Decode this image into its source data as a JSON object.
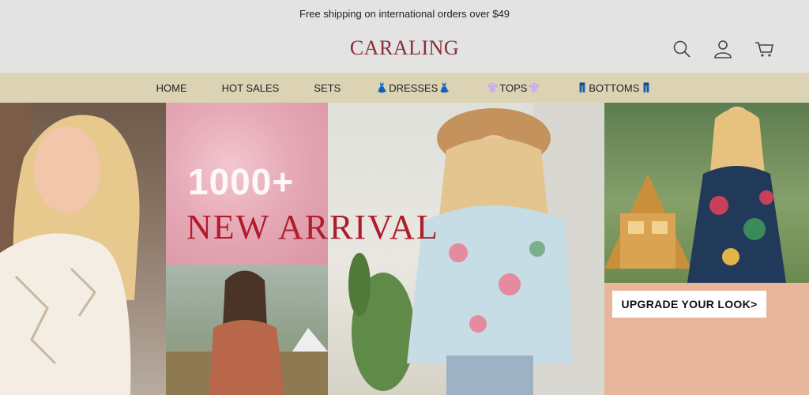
{
  "announcement": "Free shipping on international orders over $49",
  "header": {
    "logo": "CARALING",
    "icons": [
      "search-icon",
      "account-icon",
      "cart-icon"
    ]
  },
  "nav": {
    "items": [
      {
        "label": "HOME"
      },
      {
        "label": "HOT SALES"
      },
      {
        "label": "SETS"
      },
      {
        "label": "DRESSES",
        "emoji": "👗"
      },
      {
        "label": "TOPS",
        "emoji": "👚"
      },
      {
        "label": "BOTTOMS",
        "emoji": "👖"
      }
    ]
  },
  "hero": {
    "count_text": "1000+",
    "headline": "NEW ARRIVAL",
    "cta": "UPGRADE YOUR  LOOK>"
  },
  "colors": {
    "brand": "#8b2d3a",
    "nav_bg": "#dbd3b4",
    "headline": "#b01c2e",
    "page_bg": "#e3e3e3"
  }
}
